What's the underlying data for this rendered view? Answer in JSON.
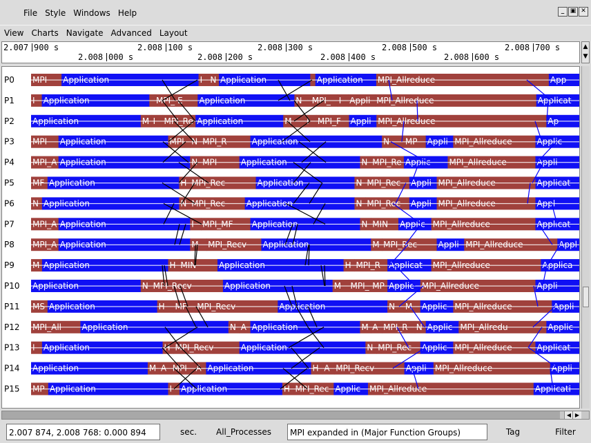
{
  "menu_primary": [
    "File",
    "Style",
    "Windows",
    "Help"
  ],
  "menu_secondary": [
    "View",
    "Charts",
    "Navigate",
    "Advanced",
    "Layout"
  ],
  "window_buttons": [
    "_",
    "▣",
    "✕"
  ],
  "time_axis": {
    "top": [
      "2.007",
      "900 s",
      "2.008",
      "100 s",
      "2.008",
      "300 s",
      "2.008",
      "500 s",
      "2.008",
      "700 s"
    ],
    "bottom": [
      "2.008",
      "000 s",
      "2.008",
      "200 s",
      "2.008",
      "400 s",
      "2.008",
      "600 s"
    ]
  },
  "processes": [
    "P0",
    "P1",
    "P2",
    "P3",
    "P4",
    "P5",
    "P6",
    "P7",
    "P8",
    "P9",
    "P10",
    "P11",
    "P12",
    "P13",
    "P14",
    "P15"
  ],
  "colors": {
    "application": "#1010f4",
    "mpi": "#a0413c",
    "message_line": "#000000",
    "reduce_line": "#0000ff",
    "separator": "#ffffff"
  },
  "rows": [
    [
      {
        "w": 6,
        "t": "mpi",
        "l": "MPI"
      },
      {
        "w": 27,
        "t": "app",
        "l": "Application"
      },
      {
        "w": 2,
        "t": "mpi",
        "l": "I"
      },
      {
        "w": 2,
        "t": "mpi",
        "l": "N"
      },
      {
        "w": 18,
        "t": "app",
        "l": "Application"
      },
      {
        "w": 1,
        "t": "mpi",
        "l": "I"
      },
      {
        "w": 12,
        "t": "app",
        "l": "Application"
      },
      {
        "w": 34,
        "t": "mpi",
        "l": "MPI_Allreduce"
      },
      {
        "w": 6,
        "t": "app",
        "l": "App"
      }
    ],
    [
      {
        "w": 2,
        "t": "mpi",
        "l": "I"
      },
      {
        "w": 20,
        "t": "app",
        "l": "Application"
      },
      {
        "w": 1,
        "t": "mpi",
        "l": "I"
      },
      {
        "w": 4,
        "t": "mpi",
        "l": "MPI_R"
      },
      {
        "w": 4,
        "t": "mpi",
        "l": "E"
      },
      {
        "w": 18,
        "t": "app",
        "l": "Application"
      },
      {
        "w": 3,
        "t": "mpi",
        "l": "N"
      },
      {
        "w": 5,
        "t": "mpi",
        "l": "MPI_"
      },
      {
        "w": 2,
        "t": "mpi",
        "l": "I"
      },
      {
        "w": 5,
        "t": "mpi",
        "l": "Applic"
      },
      {
        "w": 30,
        "t": "mpi",
        "l": "MPI_Allreduce"
      },
      {
        "w": 8,
        "t": "app",
        "l": "Applicatio"
      }
    ],
    [
      {
        "w": 20,
        "t": "app",
        "l": "Application"
      },
      {
        "w": 2,
        "t": "mpi",
        "l": "M"
      },
      {
        "w": 2,
        "t": "mpi",
        "l": "I"
      },
      {
        "w": 6,
        "t": "mpi",
        "l": "MPI_Re"
      },
      {
        "w": 16,
        "t": "app",
        "l": "Application"
      },
      {
        "w": 4,
        "t": "mpi",
        "l": "M"
      },
      {
        "w": 2,
        "t": "mpi",
        "l": "I"
      },
      {
        "w": 6,
        "t": "mpi",
        "l": "MPI_F"
      },
      {
        "w": 5,
        "t": "app",
        "l": "Applica"
      },
      {
        "w": 31,
        "t": "mpi",
        "l": "MPI_Allreduce"
      },
      {
        "w": 6,
        "t": "app",
        "l": "Ap"
      }
    ],
    [
      {
        "w": 5,
        "t": "mpi",
        "l": "MPI"
      },
      {
        "w": 20,
        "t": "app",
        "l": "Application"
      },
      {
        "w": 4,
        "t": "mpi",
        "l": "MPI"
      },
      {
        "w": 2,
        "t": "mpi",
        "l": "N"
      },
      {
        "w": 9,
        "t": "mpi",
        "l": "MPI_R"
      },
      {
        "w": 24,
        "t": "app",
        "l": "Application"
      },
      {
        "w": 4,
        "t": "mpi",
        "l": "N"
      },
      {
        "w": 4,
        "t": "mpi",
        "l": "MP"
      },
      {
        "w": 5,
        "t": "app",
        "l": "Applic"
      },
      {
        "w": 15,
        "t": "mpi",
        "l": "MPI_Allreduce"
      },
      {
        "w": 8,
        "t": "app",
        "l": "Applic"
      }
    ],
    [
      {
        "w": 5,
        "t": "mpi",
        "l": "MPI_A"
      },
      {
        "w": 24,
        "t": "app",
        "l": "Application"
      },
      {
        "w": 2,
        "t": "mpi",
        "l": "N"
      },
      {
        "w": 7,
        "t": "mpi",
        "l": "MPI"
      },
      {
        "w": 22,
        "t": "app",
        "l": "Application"
      },
      {
        "w": 2,
        "t": "mpi",
        "l": "N"
      },
      {
        "w": 6,
        "t": "mpi",
        "l": "MPI_Re"
      },
      {
        "w": 8,
        "t": "app",
        "l": "Applic"
      },
      {
        "w": 16,
        "t": "mpi",
        "l": "MPI_Allreduce"
      },
      {
        "w": 8,
        "t": "app",
        "l": "Appli"
      }
    ],
    [
      {
        "w": 3,
        "t": "mpi",
        "l": "MF"
      },
      {
        "w": 24,
        "t": "app",
        "l": "Application"
      },
      {
        "w": 2,
        "t": "mpi",
        "l": "H"
      },
      {
        "w": 12,
        "t": "mpi",
        "l": "MPI_Rec"
      },
      {
        "w": 18,
        "t": "app",
        "l": "Application"
      },
      {
        "w": 2,
        "t": "mpi",
        "l": "N"
      },
      {
        "w": 8,
        "t": "mpi",
        "l": "MPI_Rec"
      },
      {
        "w": 5,
        "t": "app",
        "l": "Applic"
      },
      {
        "w": 18,
        "t": "mpi",
        "l": "MPI_Allreduce"
      },
      {
        "w": 8,
        "t": "app",
        "l": "Applicatio"
      }
    ],
    [
      {
        "w": 2,
        "t": "mpi",
        "l": "N"
      },
      {
        "w": 25,
        "t": "app",
        "l": "Application"
      },
      {
        "w": 2,
        "t": "mpi",
        "l": "N"
      },
      {
        "w": 10,
        "t": "mpi",
        "l": "MPI_Rec"
      },
      {
        "w": 20,
        "t": "app",
        "l": "Application"
      },
      {
        "w": 2,
        "t": "mpi",
        "l": "N"
      },
      {
        "w": 8,
        "t": "mpi",
        "l": "MPI_Rec"
      },
      {
        "w": 5,
        "t": "app",
        "l": "Applic"
      },
      {
        "w": 18,
        "t": "mpi",
        "l": "MPI_Allreduce"
      },
      {
        "w": 8,
        "t": "app",
        "l": "Appl"
      }
    ],
    [
      {
        "w": 5,
        "t": "mpi",
        "l": "MPI_A"
      },
      {
        "w": 24,
        "t": "app",
        "l": "Application"
      },
      {
        "w": 2,
        "t": "mpi",
        "l": "I"
      },
      {
        "w": 9,
        "t": "mpi",
        "l": "MPI_MF"
      },
      {
        "w": 20,
        "t": "app",
        "l": "Application"
      },
      {
        "w": 2,
        "t": "mpi",
        "l": "N"
      },
      {
        "w": 5,
        "t": "mpi",
        "l": "MIN"
      },
      {
        "w": 6,
        "t": "app",
        "l": "Applica"
      },
      {
        "w": 19,
        "t": "mpi",
        "l": "MPI_Allreduce"
      },
      {
        "w": 8,
        "t": "app",
        "l": "Applicat"
      }
    ],
    [
      {
        "w": 5,
        "t": "mpi",
        "l": "MPI_A"
      },
      {
        "w": 24,
        "t": "app",
        "l": "Application"
      },
      {
        "w": 3,
        "t": "mpi",
        "l": "M"
      },
      {
        "w": 10,
        "t": "mpi",
        "l": "MPI_Recv"
      },
      {
        "w": 20,
        "t": "app",
        "l": "Application"
      },
      {
        "w": 2,
        "t": "mpi",
        "l": "M"
      },
      {
        "w": 10,
        "t": "mpi",
        "l": "MPI_Rec"
      },
      {
        "w": 5,
        "t": "app",
        "l": "Applic"
      },
      {
        "w": 17,
        "t": "mpi",
        "l": "MPI_Allreduce"
      },
      {
        "w": 4,
        "t": "app",
        "l": "Applic"
      }
    ],
    [
      {
        "w": 2,
        "t": "mpi",
        "l": "M"
      },
      {
        "w": 23,
        "t": "app",
        "l": "Application"
      },
      {
        "w": 2,
        "t": "mpi",
        "l": "H"
      },
      {
        "w": 7,
        "t": "mpi",
        "l": "MIN"
      },
      {
        "w": 23,
        "t": "app",
        "l": "Application"
      },
      {
        "w": 2,
        "t": "mpi",
        "l": "H"
      },
      {
        "w": 6,
        "t": "mpi",
        "l": "MPI_R"
      },
      {
        "w": 8,
        "t": "app",
        "l": "Applicatio"
      },
      {
        "w": 20,
        "t": "mpi",
        "l": "MPI_Allreduce"
      },
      {
        "w": 7,
        "t": "app",
        "l": "Applicat"
      }
    ],
    [
      {
        "w": 20,
        "t": "app",
        "l": "Application"
      },
      {
        "w": 2,
        "t": "mpi",
        "l": "N"
      },
      {
        "w": 13,
        "t": "mpi",
        "l": "MPI_Recv"
      },
      {
        "w": 20,
        "t": "app",
        "l": "Application"
      },
      {
        "w": 3,
        "t": "mpi",
        "l": "M"
      },
      {
        "w": 4,
        "t": "mpi",
        "l": "MPI_Re"
      },
      {
        "w": 3,
        "t": "mpi",
        "l": "MP"
      },
      {
        "w": 6,
        "t": "app",
        "l": "Applic"
      },
      {
        "w": 21,
        "t": "mpi",
        "l": "MPI_Allreduce"
      },
      {
        "w": 8,
        "t": "app",
        "l": "Appli"
      }
    ],
    [
      {
        "w": 3,
        "t": "mpi",
        "l": "MS"
      },
      {
        "w": 20,
        "t": "app",
        "l": "Application"
      },
      {
        "w": 3,
        "t": "mpi",
        "l": "H"
      },
      {
        "w": 4,
        "t": "mpi",
        "l": "MF"
      },
      {
        "w": 15,
        "t": "mpi",
        "l": "MPI_Recv"
      },
      {
        "w": 20,
        "t": "app",
        "l": "Application"
      },
      {
        "w": 3,
        "t": "mpi",
        "l": "N"
      },
      {
        "w": 3,
        "t": "mpi",
        "l": "M"
      },
      {
        "w": 6,
        "t": "app",
        "l": "Applica"
      },
      {
        "w": 18,
        "t": "mpi",
        "l": "MPI_Allreduce"
      },
      {
        "w": 5,
        "t": "app",
        "l": "Applic"
      }
    ],
    [
      {
        "w": 9,
        "t": "mpi",
        "l": "MPI_All"
      },
      {
        "w": 27,
        "t": "app",
        "l": "Application"
      },
      {
        "w": 2,
        "t": "mpi",
        "l": "N"
      },
      {
        "w": 2,
        "t": "mpi",
        "l": "A"
      },
      {
        "w": 20,
        "t": "app",
        "l": "Application"
      },
      {
        "w": 2,
        "t": "mpi",
        "l": "M"
      },
      {
        "w": 2,
        "t": "mpi",
        "l": "A"
      },
      {
        "w": 6,
        "t": "mpi",
        "l": "MPI_R"
      },
      {
        "w": 2,
        "t": "mpi",
        "l": "N"
      },
      {
        "w": 6,
        "t": "app",
        "l": "Applic"
      },
      {
        "w": 16,
        "t": "mpi",
        "l": "MPI_Allredu"
      },
      {
        "w": 6,
        "t": "app",
        "l": "Applica"
      }
    ],
    [
      {
        "w": 2,
        "t": "mpi",
        "l": "I"
      },
      {
        "w": 22,
        "t": "app",
        "l": "Application"
      },
      {
        "w": 2,
        "t": "mpi",
        "l": "H"
      },
      {
        "w": 12,
        "t": "mpi",
        "l": "MPI_Recv"
      },
      {
        "w": 23,
        "t": "app",
        "l": "Application"
      },
      {
        "w": 2,
        "t": "mpi",
        "l": "N"
      },
      {
        "w": 8,
        "t": "mpi",
        "l": "MPI_Rec"
      },
      {
        "w": 6,
        "t": "app",
        "l": "Applic"
      },
      {
        "w": 15,
        "t": "mpi",
        "l": "MPI_Allreduce"
      },
      {
        "w": 8,
        "t": "app",
        "l": "Application"
      }
    ],
    [
      {
        "w": 20,
        "t": "app",
        "l": "Application"
      },
      {
        "w": 2,
        "t": "mpi",
        "l": "M"
      },
      {
        "w": 2,
        "t": "mpi",
        "l": "A"
      },
      {
        "w": 4,
        "t": "mpi",
        "l": "MPI"
      },
      {
        "w": 2,
        "t": "mpi",
        "l": "A"
      },
      {
        "w": 18,
        "t": "app",
        "l": "Application"
      },
      {
        "w": 2,
        "t": "mpi",
        "l": "H"
      },
      {
        "w": 2,
        "t": "mpi",
        "l": "A"
      },
      {
        "w": 12,
        "t": "mpi",
        "l": "MPI_Recv"
      },
      {
        "w": 5,
        "t": "app",
        "l": "Applic"
      },
      {
        "w": 20,
        "t": "mpi",
        "l": "MPI_Allreduce"
      },
      {
        "w": 5,
        "t": "app",
        "l": "Applica"
      }
    ],
    [
      {
        "w": 3,
        "t": "mpi",
        "l": "MP"
      },
      {
        "w": 21,
        "t": "app",
        "l": "Application"
      },
      {
        "w": 2,
        "t": "mpi",
        "l": "I"
      },
      {
        "w": 18,
        "t": "app",
        "l": "Application"
      },
      {
        "w": 2,
        "t": "mpi",
        "l": "H"
      },
      {
        "w": 7,
        "t": "mpi",
        "l": "MPI_Rec"
      },
      {
        "w": 6,
        "t": "app",
        "l": "Applic"
      },
      {
        "w": 29,
        "t": "mpi",
        "l": "MPI_Allreduce"
      },
      {
        "w": 8,
        "t": "app",
        "l": "Application"
      }
    ]
  ],
  "status": {
    "coords": "2.007 874, 2.008 768: 0.000 894",
    "unit": "sec.",
    "process_group": "All_Processes",
    "view_mode": "MPI expanded in (Major Function Groups)",
    "tag": "Tag",
    "filter": "Filter"
  }
}
